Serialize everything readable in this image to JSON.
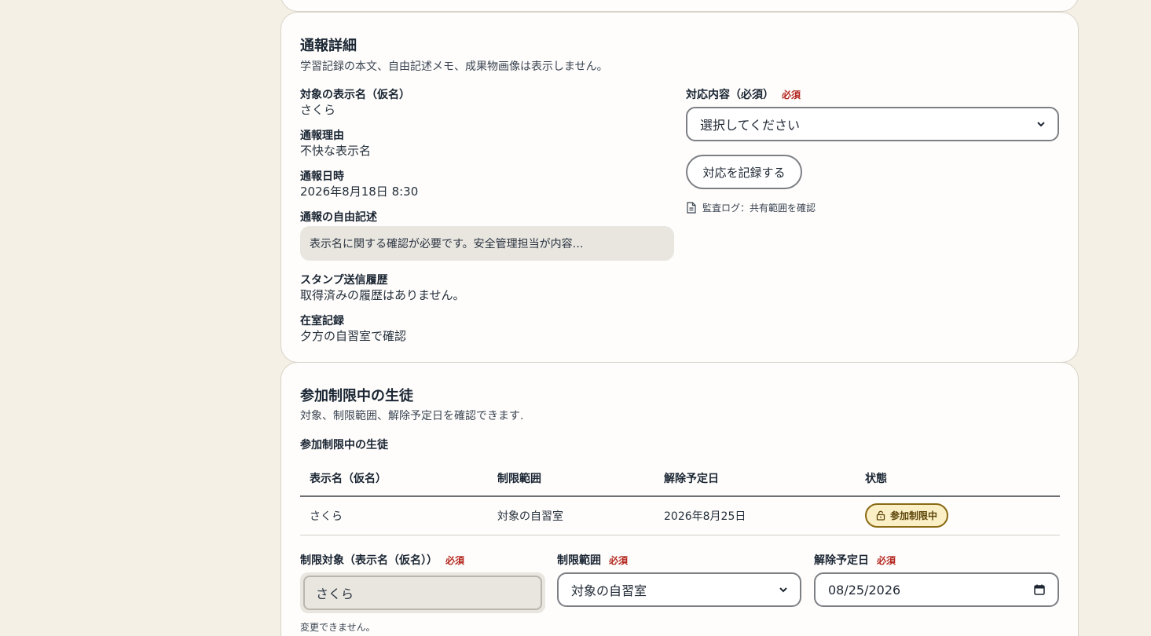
{
  "report": {
    "title": "通報詳細",
    "subtitle": "学習記録の本文、自由記述メモ、成果物画像は表示しません。",
    "fields": {
      "display_name_label": "対象の表示名（仮名）",
      "display_name_value": "さくら",
      "reason_label": "通報理由",
      "reason_value": "不快な表示名",
      "datetime_label": "通報日時",
      "datetime_value": "2026年8月18日 8:30",
      "free_text_label": "通報の自由記述",
      "free_text_value": "表示名に関する確認が必要です。安全管理担当が内容…",
      "stamp_label": "スタンプ送信履歴",
      "stamp_value": "取得済みの履歴はありません。",
      "attendance_label": "在室記録",
      "attendance_value": "夕方の自習室で確認"
    },
    "action": {
      "label": "対応内容（必須）",
      "required": "必須",
      "select_value": "選択してください",
      "submit_label": "対応を記録する",
      "audit_link": "監査ログ：共有範囲を確認"
    }
  },
  "restrictions": {
    "title": "参加制限中の生徒",
    "subtitle": "対象、制限範囲、解除予定日を確認できます.",
    "table_caption": "参加制限中の生徒",
    "columns": [
      "表示名（仮名）",
      "制限範囲",
      "解除予定日",
      "状態"
    ],
    "rows": [
      {
        "name": "さくら",
        "scope": "対象の自習室",
        "release": "2026年8月25日",
        "status": "参加制限中"
      }
    ],
    "form": {
      "target_label": "制限対象（表示名（仮名））",
      "target_required": "必須",
      "target_value": "さくら",
      "target_note": "変更できません。",
      "scope_label": "制限範囲",
      "scope_required": "必須",
      "scope_value": "対象の自習室",
      "release_label": "解除予定日",
      "release_required": "必須",
      "release_value": "08/25/2026"
    }
  },
  "colors": {
    "background": "#f4f0e6",
    "card": "#fefdfb",
    "required": "#b3261e",
    "badge_bg": "#fbefc6",
    "badge_border": "#8a6a14"
  },
  "icons": {
    "audit": "document-icon",
    "status": "lock-icon",
    "select": "chevron-down-icon",
    "date": "calendar-icon"
  }
}
